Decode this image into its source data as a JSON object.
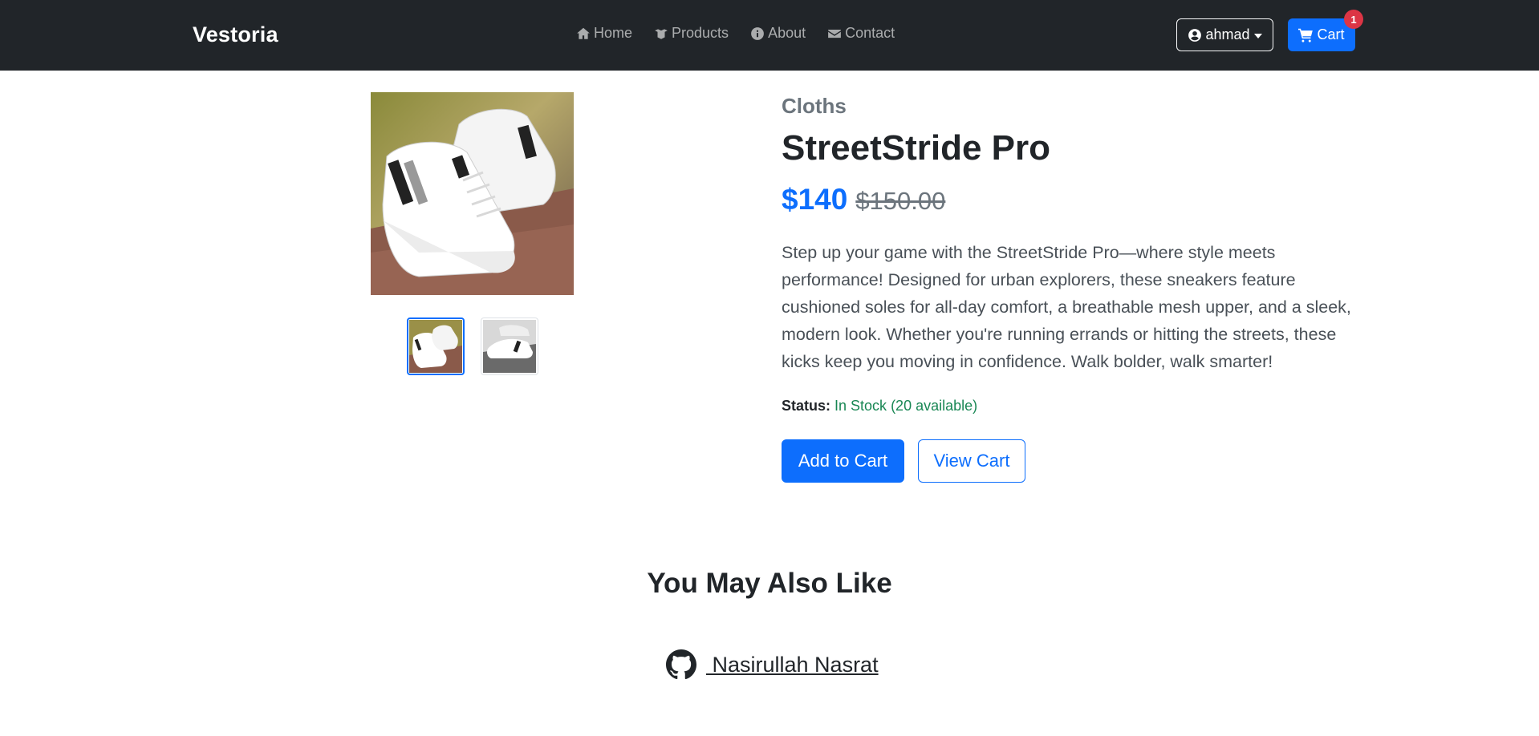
{
  "navbar": {
    "brand": "Vestoria",
    "links": [
      {
        "label": "Home",
        "icon": "home-icon"
      },
      {
        "label": "Products",
        "icon": "box-icon"
      },
      {
        "label": "About",
        "icon": "info-icon"
      },
      {
        "label": "Contact",
        "icon": "envelope-icon"
      }
    ],
    "user": {
      "name": "ahmad",
      "icon": "user-circle-icon"
    },
    "cart": {
      "label": "Cart",
      "count": "1",
      "icon": "cart-icon"
    }
  },
  "product": {
    "category": "Cloths",
    "name": "StreetStride Pro",
    "price": "$140",
    "old_price": "$150.00",
    "description": "Step up your game with the StreetStride Pro—where style meets performance! Designed for urban explorers, these sneakers feature cushioned soles for all-day comfort, a breathable mesh upper, and a sleek, modern look. Whether you're running errands or hitting the streets, these kicks keep you moving in confidence. Walk bolder, walk smarter!",
    "status_label": "Status:",
    "status_value": "In Stock (20 available)",
    "add_to_cart": "Add to Cart",
    "view_cart": "View Cart"
  },
  "related": {
    "title": "You May Also Like"
  },
  "footer": {
    "author": " Nasirullah Nasrat",
    "icon": "github-icon"
  },
  "colors": {
    "navbar_bg": "#212529",
    "primary": "#0d6efd",
    "success": "#198754",
    "danger": "#dc3545"
  }
}
